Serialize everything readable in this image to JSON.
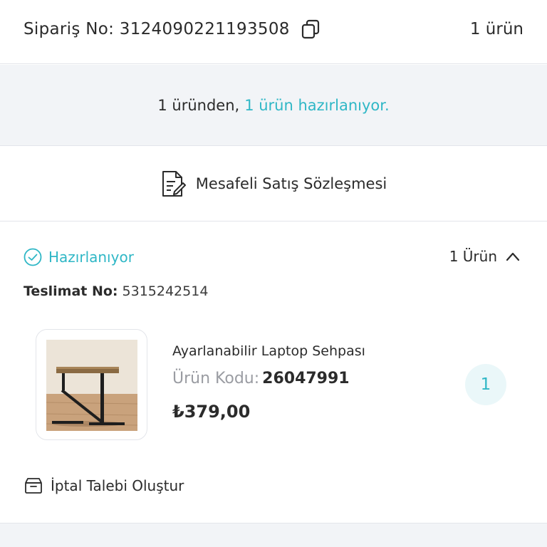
{
  "header": {
    "order_label": "Sipariş No: 3124090221193508",
    "item_count": "1 ürün"
  },
  "status_band": {
    "prefix": "1 üründen,",
    "highlight": "1 ürün hazırlanıyor."
  },
  "contract": {
    "label": "Mesafeli Satış Sözleşmesi"
  },
  "shipment": {
    "status": "Hazırlanıyor",
    "count_label": "1 Ürün",
    "delivery_label": "Teslimat No:",
    "delivery_no": "5315242514",
    "product": {
      "name": "Ayarlanabilir Laptop Sehpası",
      "code_label": "Ürün Kodu:",
      "code": "26047991",
      "price": "₺379,00",
      "quantity": "1"
    },
    "cancel_label": "İptal Talebi Oluştur"
  },
  "colors": {
    "accent": "#2fb7c6",
    "band_bg": "#f2f4f7",
    "border": "#e3e5ea",
    "text": "#2b2b2b",
    "muted": "#9a9ca2"
  },
  "icons": {
    "copy": "copy-icon",
    "contract": "document-edit-icon",
    "status": "check-circle-icon",
    "collapse": "chevron-up-icon",
    "cancel": "box-icon"
  }
}
